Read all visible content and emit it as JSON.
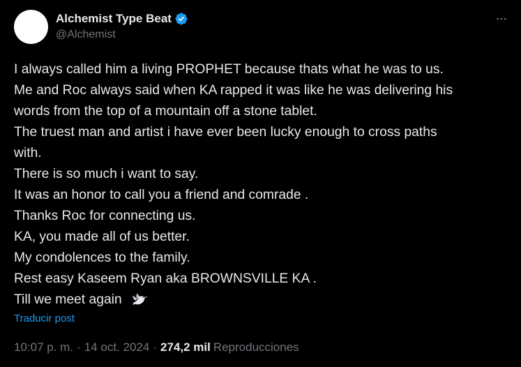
{
  "author": {
    "display_name": "Alchemist Type Beat",
    "handle": "@Alchemist",
    "verified": true,
    "avatar_color": "#ffffff",
    "verified_color": "#1d9bf0"
  },
  "more_icon": "more-horizontal-icon",
  "tweet": {
    "lines": [
      "I always called him a living PROPHET because thats what he was to us.",
      "Me and Roc always said when KA rapped it was like he was delivering his",
      "words from the top of a mountain off a stone tablet.",
      "The truest man and artist i have ever been lucky enough to cross paths",
      "with.",
      "There is so much i want to say.",
      "It was an honor to call you a friend and comrade .",
      "Thanks Roc for connecting us.",
      "KA, you made all of us better.",
      "My condolences to the family.",
      "Rest easy Kaseem Ryan aka BROWNSVILLE KA .",
      "Till we meet again"
    ],
    "emoji": "dove-icon"
  },
  "translate_label": "Traducir post",
  "meta": {
    "time": "10:07 p. m.",
    "separator": "·",
    "date": "14 oct. 2024",
    "views_count": "274,2 mil",
    "views_label": "Reproducciones"
  },
  "colors": {
    "background": "#000000",
    "text": "#e7e9ea",
    "secondary": "#71767b",
    "link": "#1d9bf0"
  }
}
